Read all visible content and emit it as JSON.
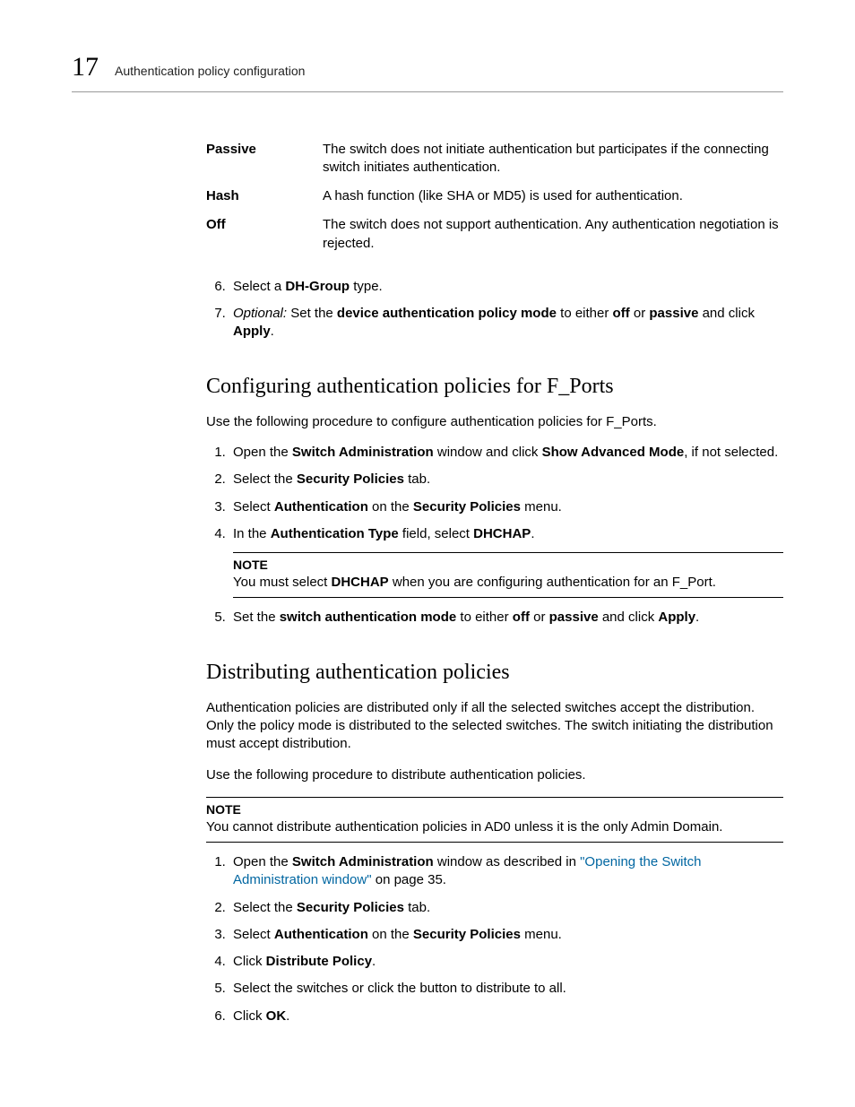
{
  "header": {
    "chapter": "17",
    "title": "Authentication policy configuration"
  },
  "defs": [
    {
      "term": "Passive",
      "desc": "The switch does not initiate authentication but participates if the connecting switch initiates authentication."
    },
    {
      "term": "Hash",
      "desc": "A hash function (like SHA or MD5) is used for authentication."
    },
    {
      "term": "Off",
      "desc": "The switch does not support authentication. Any authentication negotiation is rejected."
    }
  ],
  "topSteps": {
    "s6": {
      "pre": "Select a ",
      "b1": "DH-Group",
      "post": " type."
    },
    "s7": {
      "opt": "Optional: ",
      "a": "Set the ",
      "b1": "device authentication policy mode",
      "b": " to either ",
      "b2": "off",
      "c": " or ",
      "b3": "passive",
      "d": " and click ",
      "b4": "Apply",
      "e": "."
    }
  },
  "sec1": {
    "heading": "Configuring authentication policies for F_Ports",
    "intro": "Use the following procedure to configure authentication policies for F_Ports.",
    "step1": {
      "a": "Open the ",
      "b1": "Switch Administration",
      "b": " window and click ",
      "b2": "Show Advanced Mode",
      "c": ", if not selected."
    },
    "step2": {
      "a": "Select the ",
      "b1": "Security Policies",
      "b": " tab."
    },
    "step3": {
      "a": "Select ",
      "b1": "Authentication",
      "b": " on the ",
      "b2": "Security Policies",
      "c": " menu."
    },
    "step4": {
      "a": "In the ",
      "b1": "Authentication Type",
      "b": " field, select ",
      "b2": "DHCHAP",
      "c": "."
    },
    "note": {
      "head": "NOTE",
      "a": "You must select ",
      "b1": "DHCHAP",
      "b": " when you are configuring authentication for an F_Port."
    },
    "step5": {
      "a": "Set the ",
      "b1": "switch authentication mode",
      "b": " to either ",
      "b2": "off",
      "c": " or ",
      "b3": "passive",
      "d": " and click ",
      "b4": "Apply",
      "e": "."
    }
  },
  "sec2": {
    "heading": "Distributing authentication policies",
    "p1": "Authentication policies are distributed only if all the selected switches accept the distribution. Only the policy mode is distributed to the selected switches. The switch initiating the distribution must accept distribution.",
    "p2": "Use the following procedure to distribute authentication policies.",
    "note": {
      "head": "NOTE",
      "body": "You cannot distribute authentication policies in AD0 unless it is the only Admin Domain."
    },
    "step1": {
      "a": "Open the ",
      "b1": "Switch Administration",
      "b": " window as described in ",
      "link": "\"Opening the Switch Administration window\"",
      "c": " on page 35."
    },
    "step2": {
      "a": "Select the ",
      "b1": "Security Policies",
      "b": " tab."
    },
    "step3": {
      "a": "Select ",
      "b1": "Authentication",
      "b": " on the ",
      "b2": "Security Policies",
      "c": " menu."
    },
    "step4": {
      "a": "Click ",
      "b1": "Distribute Policy",
      "b": "."
    },
    "step5": "Select the switches or click the button to distribute to all.",
    "step6": {
      "a": "Click ",
      "b1": "OK",
      "b": "."
    }
  }
}
